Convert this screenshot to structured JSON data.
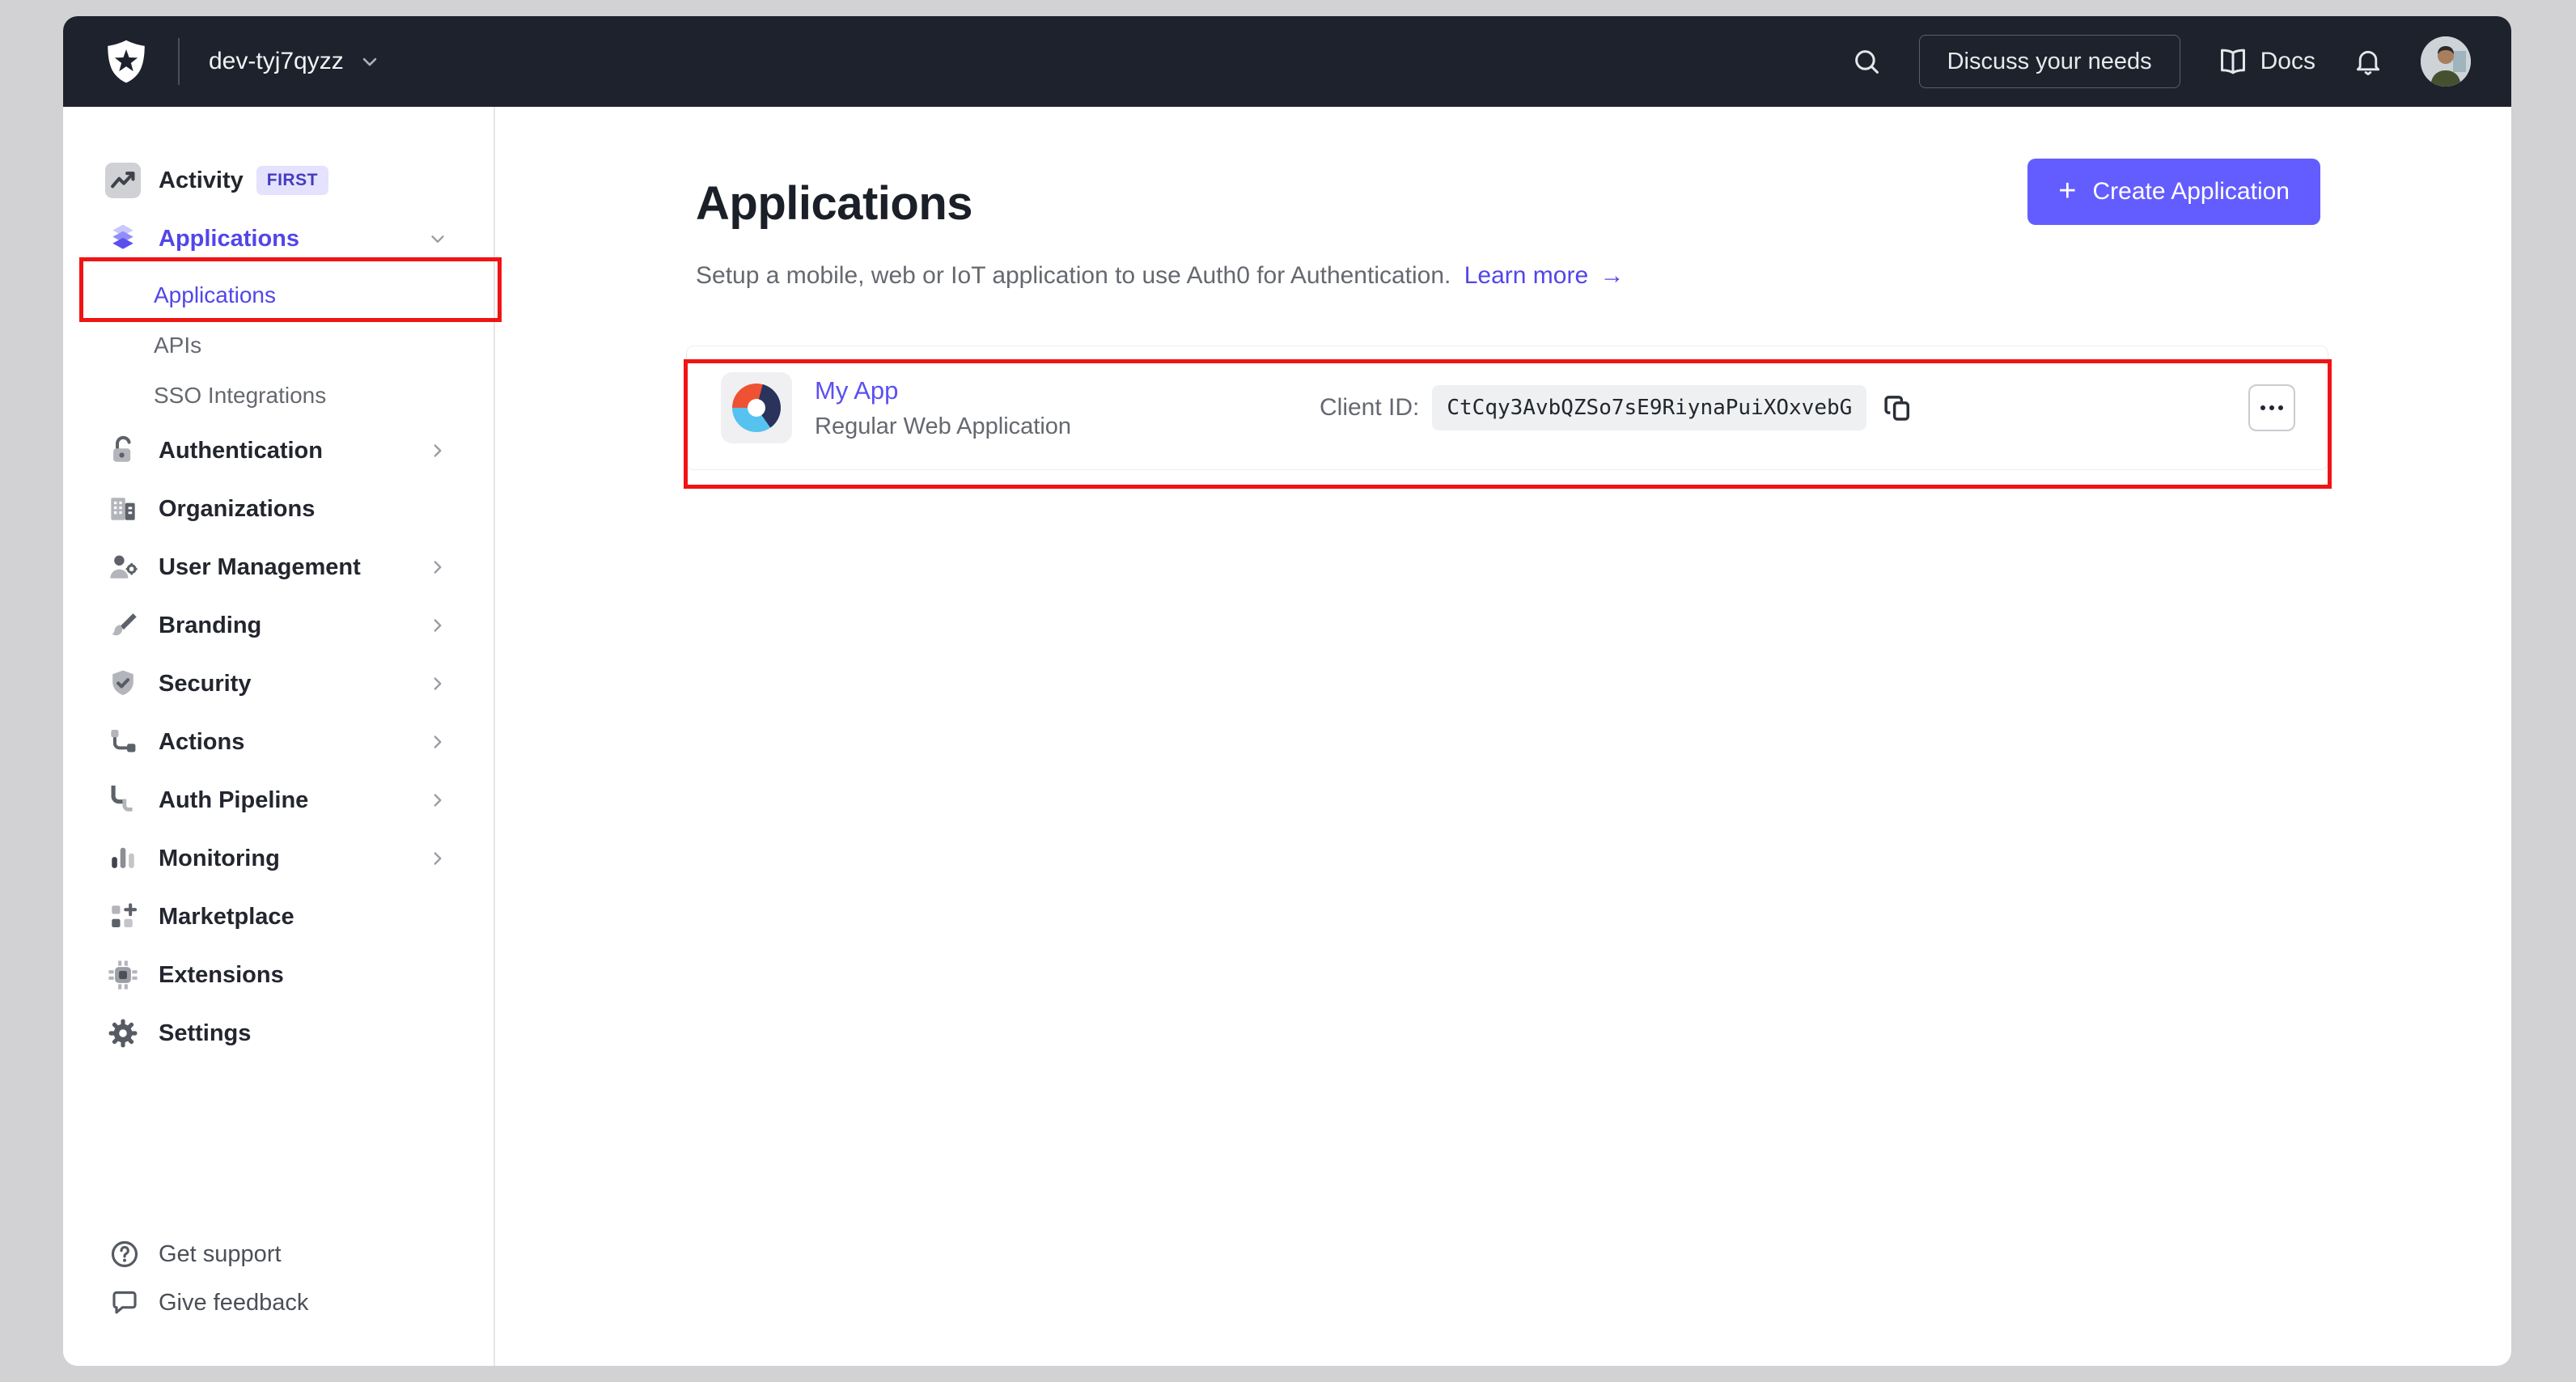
{
  "topbar": {
    "tenant": "dev-tyj7qyzz",
    "discuss_button": "Discuss your needs",
    "docs_label": "Docs"
  },
  "sidebar": {
    "items": [
      {
        "label": "Activity",
        "badge": "FIRST"
      },
      {
        "label": "Applications"
      },
      {
        "label": "Authentication"
      },
      {
        "label": "Organizations"
      },
      {
        "label": "User Management"
      },
      {
        "label": "Branding"
      },
      {
        "label": "Security"
      },
      {
        "label": "Actions"
      },
      {
        "label": "Auth Pipeline"
      },
      {
        "label": "Monitoring"
      },
      {
        "label": "Marketplace"
      },
      {
        "label": "Extensions"
      },
      {
        "label": "Settings"
      }
    ],
    "applications_children": [
      {
        "label": "Applications"
      },
      {
        "label": "APIs"
      },
      {
        "label": "SSO Integrations"
      }
    ],
    "footer": [
      {
        "label": "Get support"
      },
      {
        "label": "Give feedback"
      }
    ]
  },
  "main": {
    "title": "Applications",
    "subtitle": "Setup a mobile, web or IoT application to use Auth0 for Authentication.",
    "learn_more": "Learn more",
    "learn_more_arrow": "→",
    "create_button": "Create Application",
    "app": {
      "name": "My App",
      "type": "Regular Web Application",
      "client_id_label": "Client ID:",
      "client_id": "CtCqy3AvbQZSo7sE9RiynaPuiXOxvebG"
    }
  },
  "colors": {
    "accent": "#635dff",
    "link": "#5246e8",
    "topbar_bg": "#1d222c",
    "annotation": "#f01414",
    "text_primary": "#23262e",
    "text_secondary": "#65686f"
  }
}
